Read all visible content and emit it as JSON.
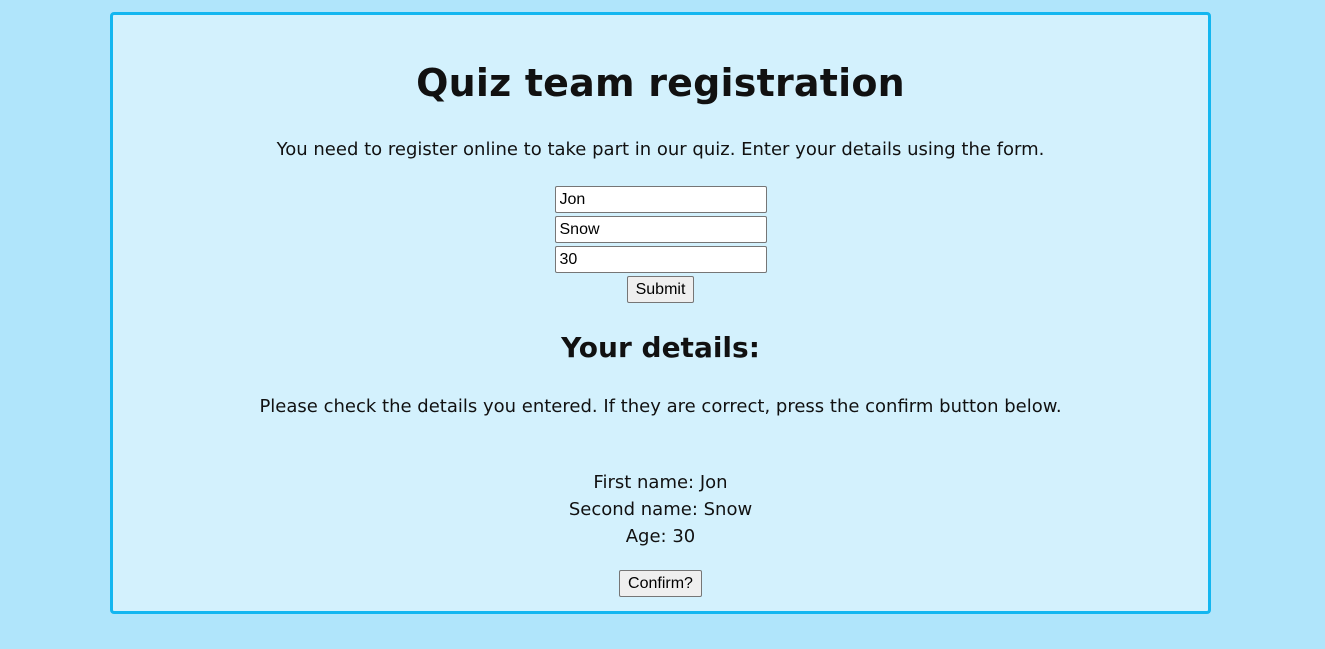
{
  "page": {
    "title": "Quiz team registration",
    "intro": "You need to register online to take part in our quiz. Enter your details using the form."
  },
  "form": {
    "first_name_value": "Jon",
    "second_name_value": "Snow",
    "age_value": "30",
    "submit_label": "Submit"
  },
  "details": {
    "heading": "Your details:",
    "instructions": "Please check the details you entered. If they are correct, press the confirm button below.",
    "first_name_line": "First name: Jon",
    "second_name_line": "Second name: Snow",
    "age_line": "Age: 30",
    "confirm_label": "Confirm?"
  },
  "colors": {
    "page_background": "#b0e5fb",
    "panel_background": "#d3f1fd",
    "panel_border": "#13b6f0"
  }
}
